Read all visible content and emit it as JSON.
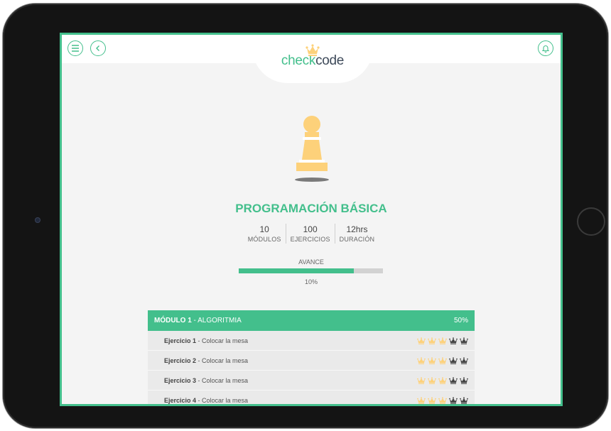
{
  "app": {
    "logo_left": "check",
    "logo_right": "code"
  },
  "course": {
    "title": "PROGRAMACIÓN BÁSICA",
    "stats": [
      {
        "value": "10",
        "label": "MÓDULOS"
      },
      {
        "value": "100",
        "label": "EJERCICIOS"
      },
      {
        "value": "12hrs",
        "label": "DURACIÓN"
      }
    ],
    "progress_label": "AVANCE",
    "progress_text": "10%",
    "progress_fraction": 0.8
  },
  "module": {
    "name": "MÓDULO 1",
    "separator": " - ",
    "topic": "ALGORITMIA",
    "progress": "50%",
    "exercises": [
      {
        "name": "Ejercicio 1",
        "sep": " - ",
        "task": "Colocar la mesa",
        "crowns_earned": 3,
        "crowns_total": 5
      },
      {
        "name": "Ejercicio 2",
        "sep": " - ",
        "task": "Colocar la mesa",
        "crowns_earned": 3,
        "crowns_total": 5
      },
      {
        "name": "Ejercicio 3",
        "sep": " - ",
        "task": "Colocar la mesa",
        "crowns_earned": 3,
        "crowns_total": 5
      },
      {
        "name": "Ejercicio 4",
        "sep": " - ",
        "task": "Colocar la mesa",
        "crowns_earned": 3,
        "crowns_total": 5
      }
    ]
  },
  "icons": {
    "menu": "menu-icon",
    "back": "back-icon",
    "notifications": "bell-icon",
    "hero": "pawn-icon",
    "rating": "crown-icon"
  },
  "colors": {
    "accent": "#43bf8c",
    "gold": "#fdd17a",
    "dark_crown": "#444444",
    "frame": "#141414"
  }
}
